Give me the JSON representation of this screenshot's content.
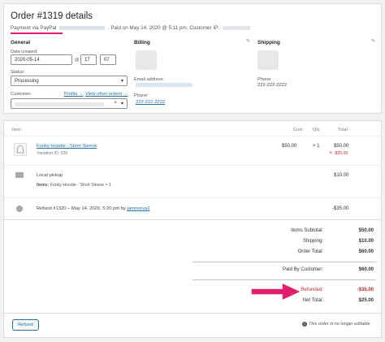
{
  "order": {
    "title": "Order #1319 details",
    "meta_prefix": "Payment via PayPal",
    "meta_suffix": ". Paid on May 14, 2020 @ 5:11 pm. Customer IP:"
  },
  "general": {
    "heading": "General",
    "date_label": "Date created:",
    "date_value": "2020-05-14",
    "hour_value": "17",
    "at_sign": "@",
    "minute_value": "07",
    "status_label": "Status:",
    "status_value": "Processing",
    "customer_label": "Customer:",
    "profile_link": "Profile →",
    "other_orders_link": "View other orders →"
  },
  "billing": {
    "heading": "Billing",
    "email_label": "Email address:",
    "phone_label": "Phone:",
    "phone_value": "222-222-2222"
  },
  "shipping": {
    "heading": "Shipping",
    "phone_label": "Phone:",
    "phone_value": "222-222-2222"
  },
  "items_table": {
    "headers": {
      "item": "Item",
      "cost": "Cost",
      "qty": "Qty",
      "total": "Total"
    },
    "product": {
      "name": "Funky Hoodie - Short Sleeve",
      "variation": "Variation ID: 536",
      "cost": "$50.00",
      "qty": "× 1",
      "total": "$50.00",
      "refund": "↰ -$35.00"
    },
    "shipping_line": {
      "name": "Local pickup",
      "items_label": "Items:",
      "items_value": "Funky Hoodie - Short Sleeve × 1",
      "total": "$10.00"
    },
    "refund_line": {
      "prefix": "Refund #1320 – May 14, 2020, 5:20 pm by",
      "user": "jamosova2",
      "amount": "-$35.00"
    }
  },
  "totals": {
    "items_subtotal_label": "Items Subtotal:",
    "items_subtotal": "$50.00",
    "shipping_label": "Shipping:",
    "shipping": "$10.00",
    "order_total_label": "Order Total:",
    "order_total": "$60.00",
    "paid_label": "Paid By Customer:",
    "paid": "$60.00",
    "refunded_label": "Refunded:",
    "refunded": "-$35.00",
    "net_label": "Net Total:",
    "net": "$25.00"
  },
  "footer": {
    "refund_button": "Refund",
    "not_editable": "This order is no longer editable."
  },
  "colors": {
    "accent": "#e11d6d",
    "link": "#2271b1",
    "refund_red": "#b32d2e"
  }
}
